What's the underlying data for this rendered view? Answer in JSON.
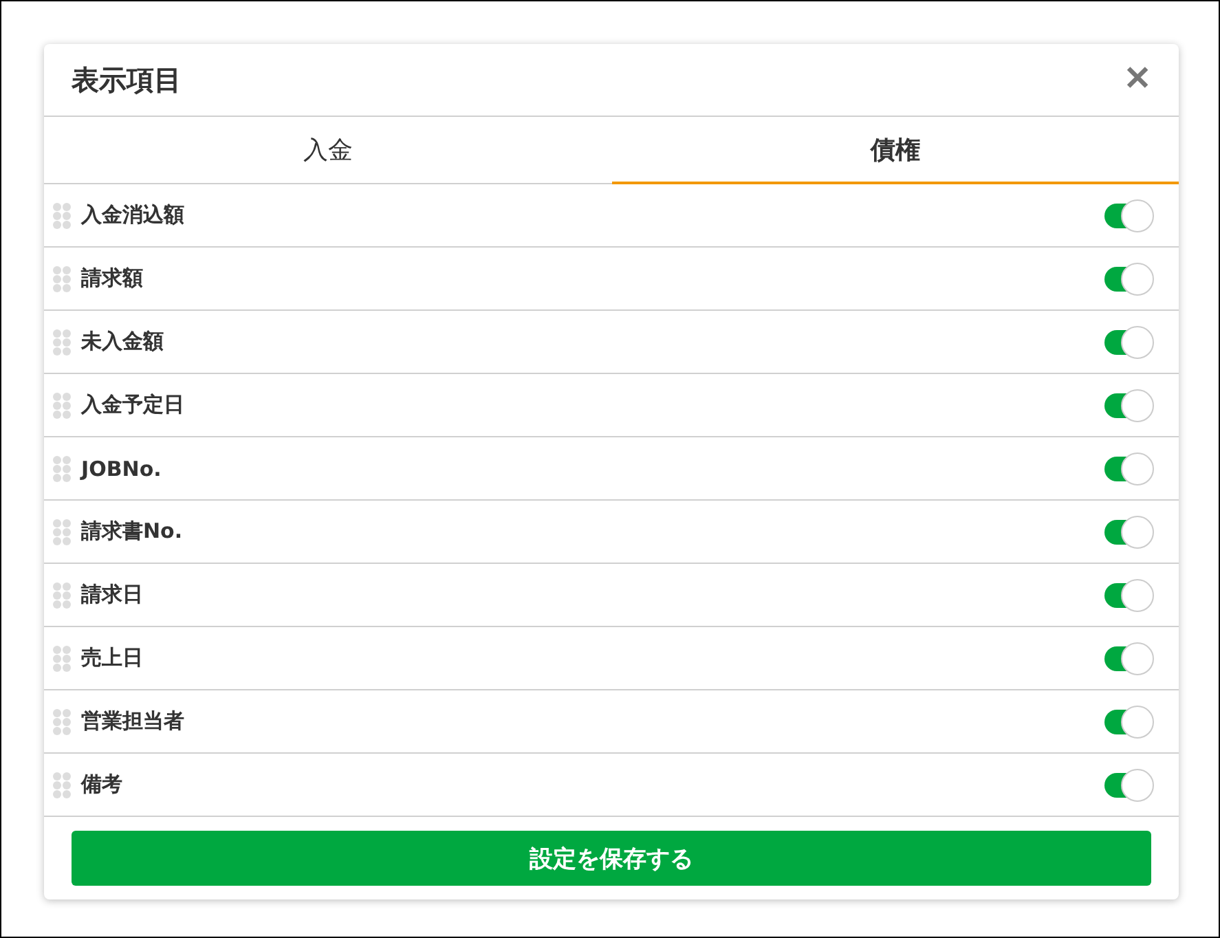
{
  "dialog": {
    "title": "表示項目",
    "close_label": "✕"
  },
  "tabs": [
    {
      "label": "入金",
      "selected": false
    },
    {
      "label": "債権",
      "selected": true
    }
  ],
  "items": [
    {
      "label": "入金消込額",
      "on": true
    },
    {
      "label": "請求額",
      "on": true
    },
    {
      "label": "未入金額",
      "on": true
    },
    {
      "label": "入金予定日",
      "on": true
    },
    {
      "label": "JOBNo.",
      "on": true
    },
    {
      "label": "請求書No.",
      "on": true
    },
    {
      "label": "請求日",
      "on": true
    },
    {
      "label": "売上日",
      "on": true
    },
    {
      "label": "営業担当者",
      "on": true
    },
    {
      "label": "備考",
      "on": true
    }
  ],
  "save_button": "設定を保存する"
}
